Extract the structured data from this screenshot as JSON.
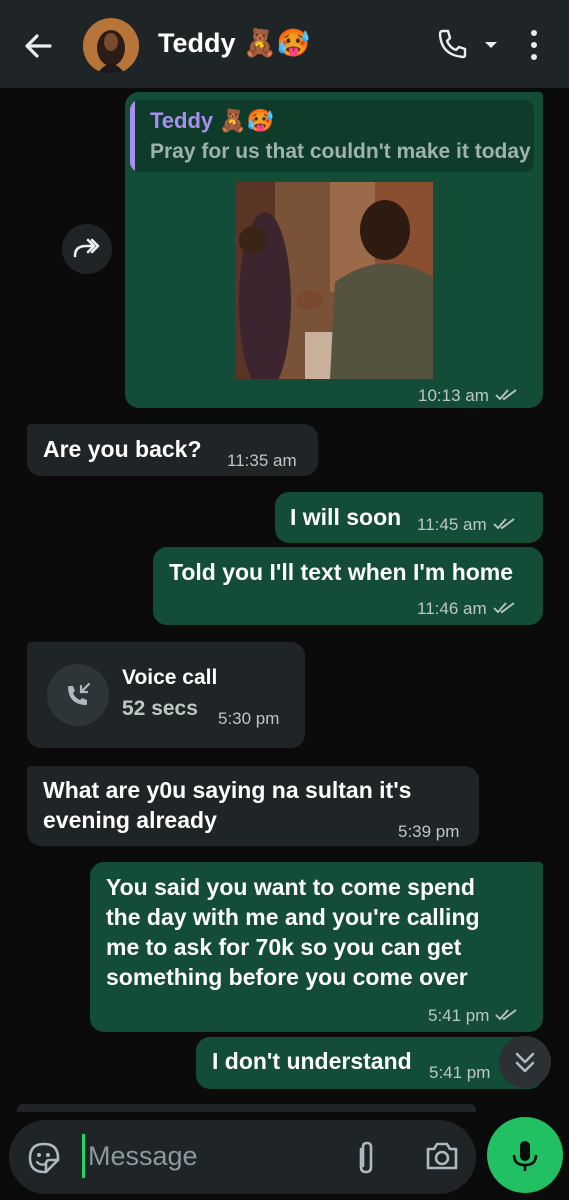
{
  "header": {
    "contact_name": "Teddy 🧸🥵",
    "icons": [
      "back-arrow-icon",
      "avatar",
      "phone-icon",
      "chevron-down-icon",
      "more-vertical-icon"
    ]
  },
  "colors": {
    "background": "#0b0b0b",
    "header": "#1f2427",
    "outgoing_bubble": "#144d37",
    "incoming_bubble": "#1f2427",
    "quote_accent": "#a98ef0",
    "mic_button": "#21c063"
  },
  "messages": [
    {
      "direction": "outgoing",
      "type": "video-reply",
      "quoted": {
        "author": "Teddy 🧸🥵",
        "text": "Pray for us that couldn't make it today"
      },
      "time": "10:13 am",
      "status": "read"
    },
    {
      "direction": "incoming",
      "text": "Are you back?",
      "time": "11:35 am"
    },
    {
      "direction": "outgoing",
      "text": "I will soon",
      "time": "11:45 am",
      "status": "read"
    },
    {
      "direction": "outgoing",
      "text": "Told you I'll text when I'm home",
      "time": "11:46 am",
      "status": "read"
    },
    {
      "direction": "incoming",
      "type": "voice-call",
      "title": "Voice call",
      "duration": "52 secs",
      "time": "5:30 pm"
    },
    {
      "direction": "incoming",
      "lines": [
        "What are y0u saying na sultan it's",
        "evening already"
      ],
      "time": "5:39 pm"
    },
    {
      "direction": "outgoing",
      "lines": [
        "You said you want to come spend",
        "the day with me and you're calling",
        "me to ask for 70k so you can get",
        "something before you come over"
      ],
      "time": "5:41 pm",
      "status": "read"
    },
    {
      "direction": "outgoing",
      "text": "I don't understand",
      "time": "5:41 pm"
    }
  ],
  "composer": {
    "placeholder": "Message",
    "icons": [
      "sticker-icon",
      "paperclip-icon",
      "camera-icon",
      "mic-icon"
    ]
  }
}
